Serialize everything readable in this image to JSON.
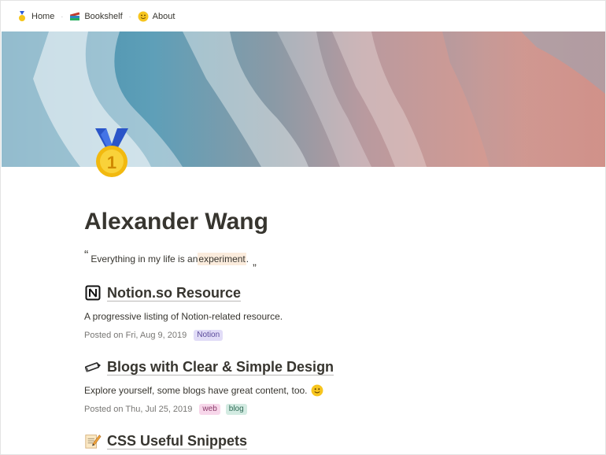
{
  "nav": {
    "items": [
      {
        "icon": "medal-icon",
        "label": "Home"
      },
      {
        "icon": "books-icon",
        "label": "Bookshelf"
      },
      {
        "icon": "smile-icon",
        "label": "About"
      }
    ],
    "separator": "·"
  },
  "page": {
    "icon": "first-place-medal-icon",
    "title": "Alexander Wang",
    "quote": {
      "open": "“",
      "text_before": "Everything in my life is an ",
      "highlight": "experiment",
      "text_after": ".",
      "close": "„"
    }
  },
  "posts": [
    {
      "icon": "notion-logo-icon",
      "title": "Notion.so Resource",
      "description": "A progressive listing of Notion-related resource.",
      "date": "Posted on Fri, Aug 9, 2019",
      "tags": [
        {
          "label": "Notion",
          "bg": "#e1dcf7",
          "color": "#5a4a9a"
        }
      ]
    },
    {
      "icon": "pencil-icon",
      "title": "Blogs with Clear & Simple Design",
      "description": "Explore yourself, some blogs have great content, too.",
      "description_emoji": "smile-icon",
      "date": "Posted on Thu, Jul 25, 2019",
      "tags": [
        {
          "label": "web",
          "bg": "#f7d7ea",
          "color": "#8a3a6a"
        },
        {
          "label": "blog",
          "bg": "#d3ebe2",
          "color": "#2f6b56"
        }
      ]
    },
    {
      "icon": "memo-icon",
      "title": "CSS Useful Snippets"
    }
  ],
  "colors": {
    "text": "#37352f",
    "muted": "#787774",
    "highlight": "#fbecdd"
  }
}
